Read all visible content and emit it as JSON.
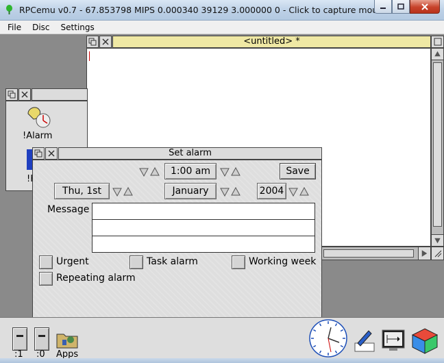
{
  "host": {
    "title": "RPCemu v0.7 - 67.853798 MIPS 0.000340 39129 3.000000 0 - Click to capture mouse",
    "menu": [
      "File",
      "Disc",
      "Settings"
    ]
  },
  "editor": {
    "title": "<untitled> *"
  },
  "filer": {
    "items": [
      {
        "label": "!Alarm",
        "icon": "alarm-bell-icon"
      },
      {
        "label": "!H",
        "icon": "help-app-icon"
      }
    ]
  },
  "alarm_dialog": {
    "title": "Set alarm",
    "time": "1:00 am",
    "save_label": "Save",
    "day": "Thu, 1st",
    "month": "January",
    "year": "2004",
    "message_label": "Message",
    "message_lines": [
      "",
      "",
      ""
    ],
    "options": [
      {
        "label": "Urgent",
        "checked": false
      },
      {
        "label": "Task alarm",
        "checked": false
      },
      {
        "label": "Working week",
        "checked": false
      },
      {
        "label": "Repeating alarm",
        "checked": false
      }
    ]
  },
  "iconbar": {
    "drives": [
      ":1",
      ":0"
    ],
    "apps_label": "Apps",
    "right_icons": [
      "clock-icon",
      "edit-pen-icon",
      "display-mode-icon",
      "risc-os-cube-icon"
    ]
  },
  "colors": {
    "editor_title_bg": "#efe8a4",
    "desktop_bg": "#8a8a8a",
    "window_bg": "#dedede"
  }
}
